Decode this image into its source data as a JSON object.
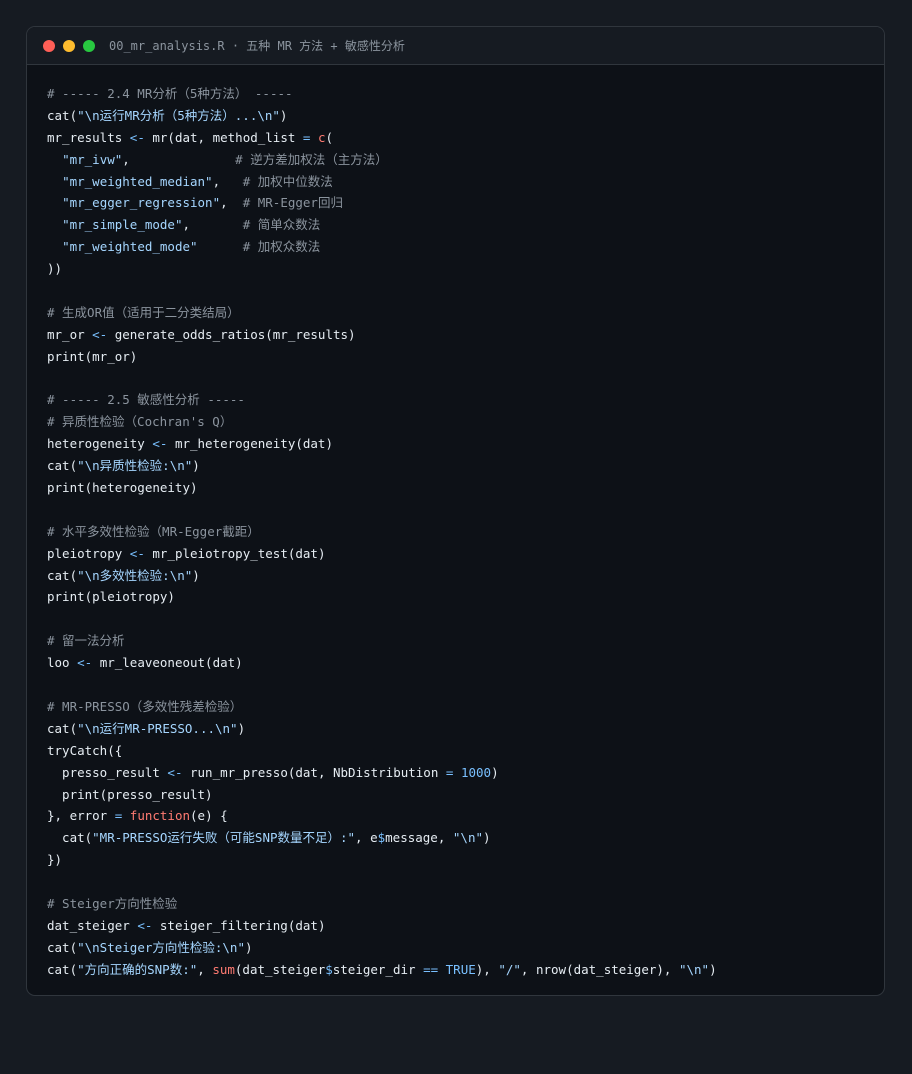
{
  "window": {
    "title": "00_mr_analysis.R · 五种 MR 方法 + 敏感性分析",
    "controls": {
      "close_color": "#ff5f57",
      "minimize_color": "#febc2e",
      "zoom_color": "#28c840"
    }
  },
  "code": {
    "language": "R",
    "lines": [
      [
        [
          "c",
          "# ----- 2.4 MR分析（5种方法） -----"
        ]
      ],
      [
        [
          "p",
          "cat("
        ],
        [
          "s",
          "\"\\n运行MR分析（5种方法）...\\n\""
        ],
        [
          "p",
          ")"
        ]
      ],
      [
        [
          "p",
          "mr_results "
        ],
        [
          "o",
          "<-"
        ],
        [
          "p",
          " mr(dat, method_list "
        ],
        [
          "o",
          "="
        ],
        [
          "p",
          " "
        ],
        [
          "k",
          "c"
        ],
        [
          "p",
          "("
        ]
      ],
      [
        [
          "p",
          "  "
        ],
        [
          "s",
          "\"mr_ivw\""
        ],
        [
          "p",
          ",              "
        ],
        [
          "c",
          "# 逆方差加权法（主方法）"
        ]
      ],
      [
        [
          "p",
          "  "
        ],
        [
          "s",
          "\"mr_weighted_median\""
        ],
        [
          "p",
          ",   "
        ],
        [
          "c",
          "# 加权中位数法"
        ]
      ],
      [
        [
          "p",
          "  "
        ],
        [
          "s",
          "\"mr_egger_regression\""
        ],
        [
          "p",
          ",  "
        ],
        [
          "c",
          "# MR-Egger回归"
        ]
      ],
      [
        [
          "p",
          "  "
        ],
        [
          "s",
          "\"mr_simple_mode\""
        ],
        [
          "p",
          ",       "
        ],
        [
          "c",
          "# 简单众数法"
        ]
      ],
      [
        [
          "p",
          "  "
        ],
        [
          "s",
          "\"mr_weighted_mode\""
        ],
        [
          "p",
          "      "
        ],
        [
          "c",
          "# 加权众数法"
        ]
      ],
      [
        [
          "p",
          "))"
        ]
      ],
      [],
      [
        [
          "c",
          "# 生成OR值（适用于二分类结局）"
        ]
      ],
      [
        [
          "p",
          "mr_or "
        ],
        [
          "o",
          "<-"
        ],
        [
          "p",
          " generate_odds_ratios(mr_results)"
        ]
      ],
      [
        [
          "p",
          "print(mr_or)"
        ]
      ],
      [],
      [
        [
          "c",
          "# ----- 2.5 敏感性分析 -----"
        ]
      ],
      [
        [
          "c",
          "# 异质性检验（Cochran's Q）"
        ]
      ],
      [
        [
          "p",
          "heterogeneity "
        ],
        [
          "o",
          "<-"
        ],
        [
          "p",
          " mr_heterogeneity(dat)"
        ]
      ],
      [
        [
          "p",
          "cat("
        ],
        [
          "s",
          "\"\\n异质性检验:\\n\""
        ],
        [
          "p",
          ")"
        ]
      ],
      [
        [
          "p",
          "print(heterogeneity)"
        ]
      ],
      [],
      [
        [
          "c",
          "# 水平多效性检验（MR-Egger截距）"
        ]
      ],
      [
        [
          "p",
          "pleiotropy "
        ],
        [
          "o",
          "<-"
        ],
        [
          "p",
          " mr_pleiotropy_test(dat)"
        ]
      ],
      [
        [
          "p",
          "cat("
        ],
        [
          "s",
          "\"\\n多效性检验:\\n\""
        ],
        [
          "p",
          ")"
        ]
      ],
      [
        [
          "p",
          "print(pleiotropy)"
        ]
      ],
      [],
      [
        [
          "c",
          "# 留一法分析"
        ]
      ],
      [
        [
          "p",
          "loo "
        ],
        [
          "o",
          "<-"
        ],
        [
          "p",
          " mr_leaveoneout(dat)"
        ]
      ],
      [],
      [
        [
          "c",
          "# MR-PRESSO（多效性残差检验）"
        ]
      ],
      [
        [
          "p",
          "cat("
        ],
        [
          "s",
          "\"\\n运行MR-PRESSO...\\n\""
        ],
        [
          "p",
          ")"
        ]
      ],
      [
        [
          "p",
          "tryCatch({"
        ]
      ],
      [
        [
          "p",
          "  presso_result "
        ],
        [
          "o",
          "<-"
        ],
        [
          "p",
          " run_mr_presso(dat, NbDistribution "
        ],
        [
          "o",
          "="
        ],
        [
          "p",
          " "
        ],
        [
          "n",
          "1000"
        ],
        [
          "p",
          ")"
        ]
      ],
      [
        [
          "p",
          "  print(presso_result)"
        ]
      ],
      [
        [
          "p",
          "}, error "
        ],
        [
          "o",
          "="
        ],
        [
          "p",
          " "
        ],
        [
          "k",
          "function"
        ],
        [
          "p",
          "(e) {"
        ]
      ],
      [
        [
          "p",
          "  cat("
        ],
        [
          "s",
          "\"MR-PRESSO运行失败（可能SNP数量不足）:\""
        ],
        [
          "p",
          ", e"
        ],
        [
          "o",
          "$"
        ],
        [
          "p",
          "message, "
        ],
        [
          "s",
          "\"\\n\""
        ],
        [
          "p",
          ")"
        ]
      ],
      [
        [
          "p",
          "})"
        ]
      ],
      [],
      [
        [
          "c",
          "# Steiger方向性检验"
        ]
      ],
      [
        [
          "p",
          "dat_steiger "
        ],
        [
          "o",
          "<-"
        ],
        [
          "p",
          " steiger_filtering(dat)"
        ]
      ],
      [
        [
          "p",
          "cat("
        ],
        [
          "s",
          "\"\\nSteiger方向性检验:\\n\""
        ],
        [
          "p",
          ")"
        ]
      ],
      [
        [
          "p",
          "cat("
        ],
        [
          "s",
          "\"方向正确的SNP数:\""
        ],
        [
          "p",
          ", "
        ],
        [
          "k",
          "sum"
        ],
        [
          "p",
          "(dat_steiger"
        ],
        [
          "o",
          "$"
        ],
        [
          "p",
          "steiger_dir "
        ],
        [
          "o",
          "=="
        ],
        [
          "p",
          " "
        ],
        [
          "n",
          "TRUE"
        ],
        [
          "p",
          "), "
        ],
        [
          "s",
          "\"/\""
        ],
        [
          "p",
          ", nrow(dat_steiger), "
        ],
        [
          "s",
          "\"\\n\""
        ],
        [
          "p",
          ")"
        ]
      ]
    ]
  }
}
